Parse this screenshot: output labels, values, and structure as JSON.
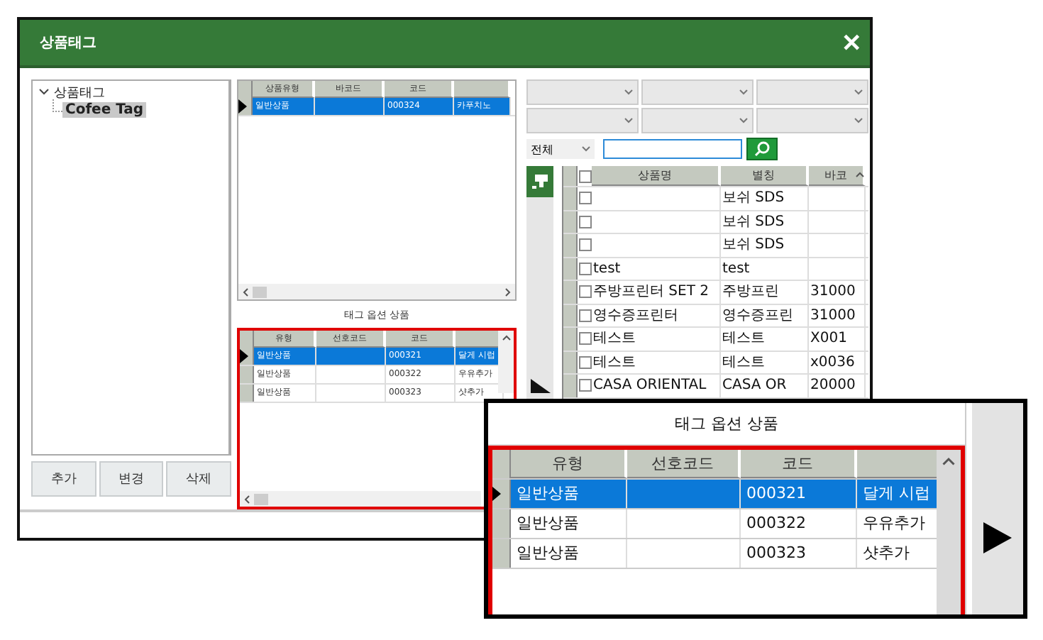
{
  "window": {
    "title": "상품태그",
    "close": "✕"
  },
  "tree": {
    "label": "상품태그",
    "expanded": true,
    "children": [
      {
        "label": "Cofee Tag",
        "selected": true
      }
    ]
  },
  "buttons": [
    "추가",
    "변경",
    "삭제"
  ],
  "product_grid": {
    "columns": [
      "상품유형",
      "바코드",
      "코드",
      ""
    ],
    "rows": [
      {
        "cells": [
          "일반상품",
          "",
          "000324",
          "카푸치노"
        ],
        "selected": true
      }
    ]
  },
  "option_label": "태그 옵션 상품",
  "option_grid": {
    "columns": [
      "유형",
      "선호코드",
      "코드",
      ""
    ],
    "rows": [
      {
        "cells": [
          "일반상품",
          "",
          "000321",
          "달게 시럽"
        ],
        "selected": true
      },
      {
        "cells": [
          "일반상품",
          "",
          "000322",
          "우유추가"
        ],
        "selected": false
      },
      {
        "cells": [
          "일반상품",
          "",
          "000323",
          "샷추가"
        ],
        "selected": false
      }
    ]
  },
  "filters": {
    "category": "전체"
  },
  "item_grid": {
    "columns": [
      "상품명",
      "별칭",
      "바코"
    ],
    "header_checked": false,
    "rows": [
      {
        "cells": [
          "",
          "보쉬 SDS",
          ""
        ],
        "checked": false
      },
      {
        "cells": [
          "",
          "보쉬 SDS",
          ""
        ],
        "checked": false
      },
      {
        "cells": [
          "",
          "보쉬 SDS",
          ""
        ],
        "checked": false
      },
      {
        "cells": [
          "test",
          "test",
          ""
        ],
        "checked": false
      },
      {
        "cells": [
          "주방프린터 SET 2",
          "주방프린",
          "31000"
        ],
        "checked": false
      },
      {
        "cells": [
          "영수증프린터",
          "영수증프린",
          "31000"
        ],
        "checked": false
      },
      {
        "cells": [
          "테스트",
          "테스트",
          "X001"
        ],
        "checked": false
      },
      {
        "cells": [
          "테스트",
          "테스트",
          "x0036"
        ],
        "checked": false
      },
      {
        "cells": [
          "CASA ORIENTAL",
          "CASA OR",
          "20000"
        ],
        "checked": false
      }
    ]
  },
  "callout": {
    "title": "태그 옵션 상품",
    "columns": [
      "유형",
      "선호코드",
      "코드",
      ""
    ],
    "rows": [
      {
        "cells": [
          "일반상품",
          "",
          "000321",
          "달게 시럽"
        ],
        "selected": true
      },
      {
        "cells": [
          "일반상품",
          "",
          "000322",
          "우유추가"
        ],
        "selected": false
      },
      {
        "cells": [
          "일반상품",
          "",
          "000323",
          "샷추가"
        ],
        "selected": false
      }
    ]
  }
}
